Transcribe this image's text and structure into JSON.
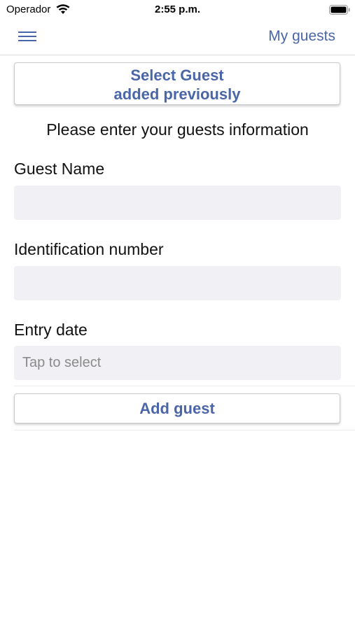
{
  "status_bar": {
    "carrier": "Operador",
    "time": "2:55 p.m.",
    "wifi_icon": "wifi-icon",
    "battery_icon": "battery-icon"
  },
  "nav": {
    "menu_icon": "hamburger-menu-icon",
    "title": "My guests",
    "accent_color": "#4a66a8"
  },
  "select_guest_button": {
    "line1": "Select Guest",
    "line2": "added previously"
  },
  "instructions": "Please enter your guests information",
  "form": {
    "guest_name": {
      "label": "Guest Name",
      "value": "",
      "placeholder": ""
    },
    "identification_number": {
      "label": "Identification number",
      "value": "",
      "placeholder": ""
    },
    "entry_date": {
      "label": "Entry date",
      "value": "",
      "placeholder": "Tap to select"
    }
  },
  "add_guest_button": {
    "label": "Add guest"
  }
}
